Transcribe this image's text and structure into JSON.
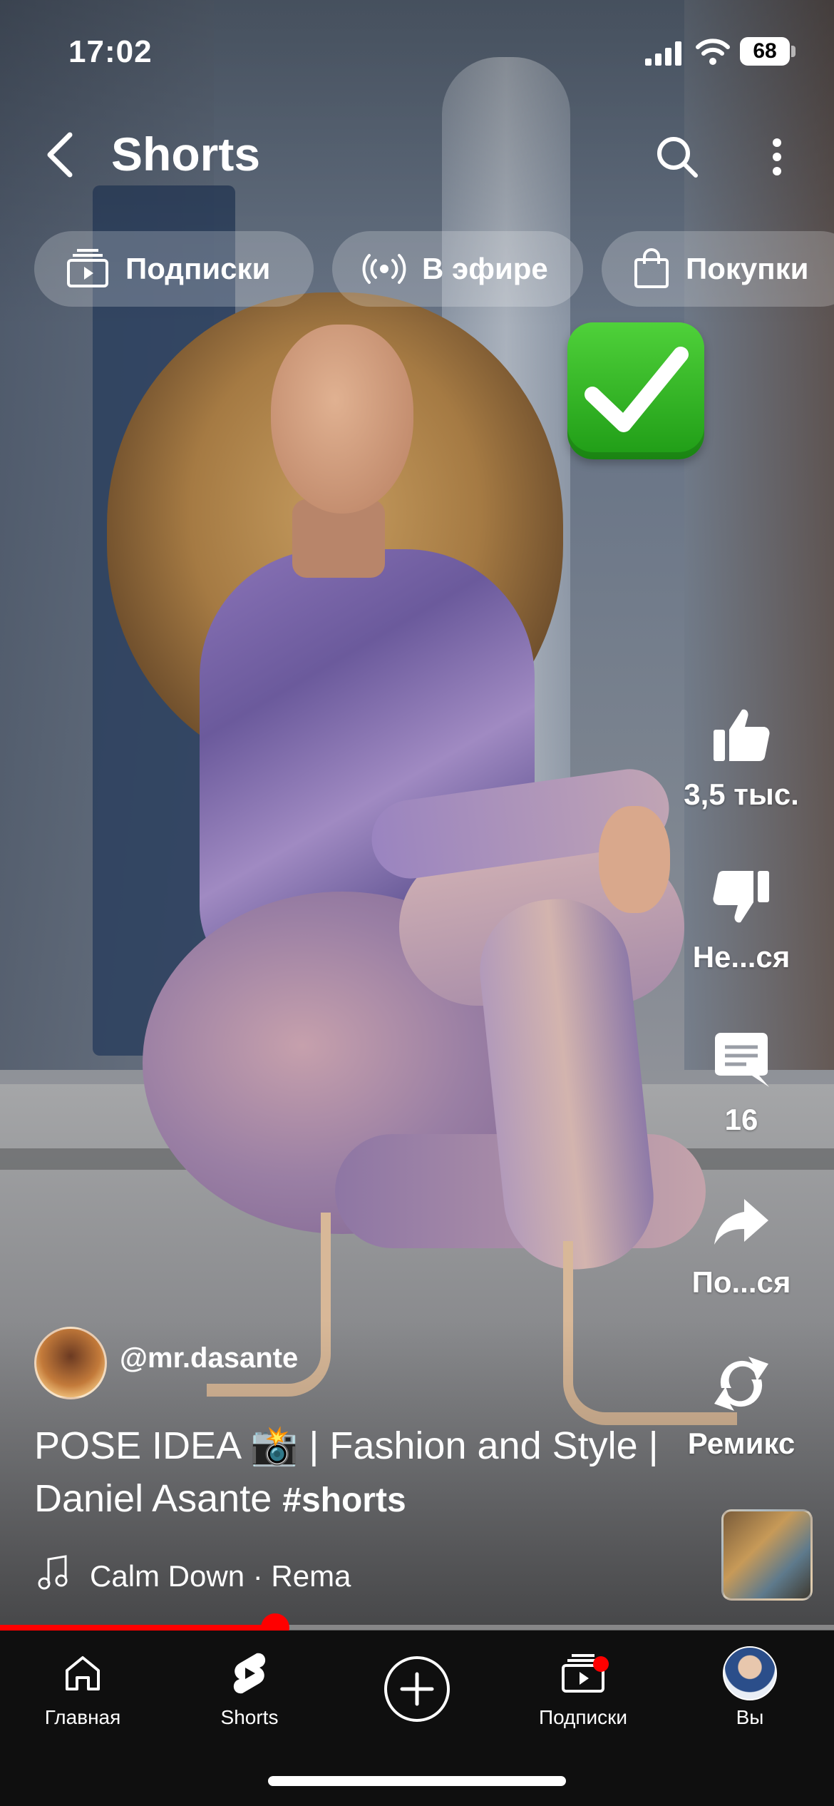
{
  "status_bar": {
    "time": "17:02",
    "battery": "68"
  },
  "header": {
    "title": "Shorts"
  },
  "chips": [
    {
      "label": "Подписки",
      "icon": "subscriptions-icon"
    },
    {
      "label": "В эфире",
      "icon": "live-icon"
    },
    {
      "label": "Покупки",
      "icon": "shopping-bag-icon"
    }
  ],
  "actions": {
    "like": "3,5 тыс.",
    "dislike": "Не...ся",
    "comments": "16",
    "share": "По...ся",
    "remix": "Ремикс"
  },
  "video": {
    "channel": "@mr.dasante",
    "caption": "POSE IDEA 📸 | Fashion and Style | Daniel Asante",
    "hashtag": "#shorts",
    "music": "Calm Down · Rema",
    "progress": 0.33
  },
  "nav": {
    "home": "Главная",
    "shorts": "Shorts",
    "subscriptions": "Подписки",
    "you": "Вы"
  },
  "colors": {
    "accent": "#ff0000",
    "nav_bg": "#0f0f0f",
    "check": "#2fb41f"
  }
}
